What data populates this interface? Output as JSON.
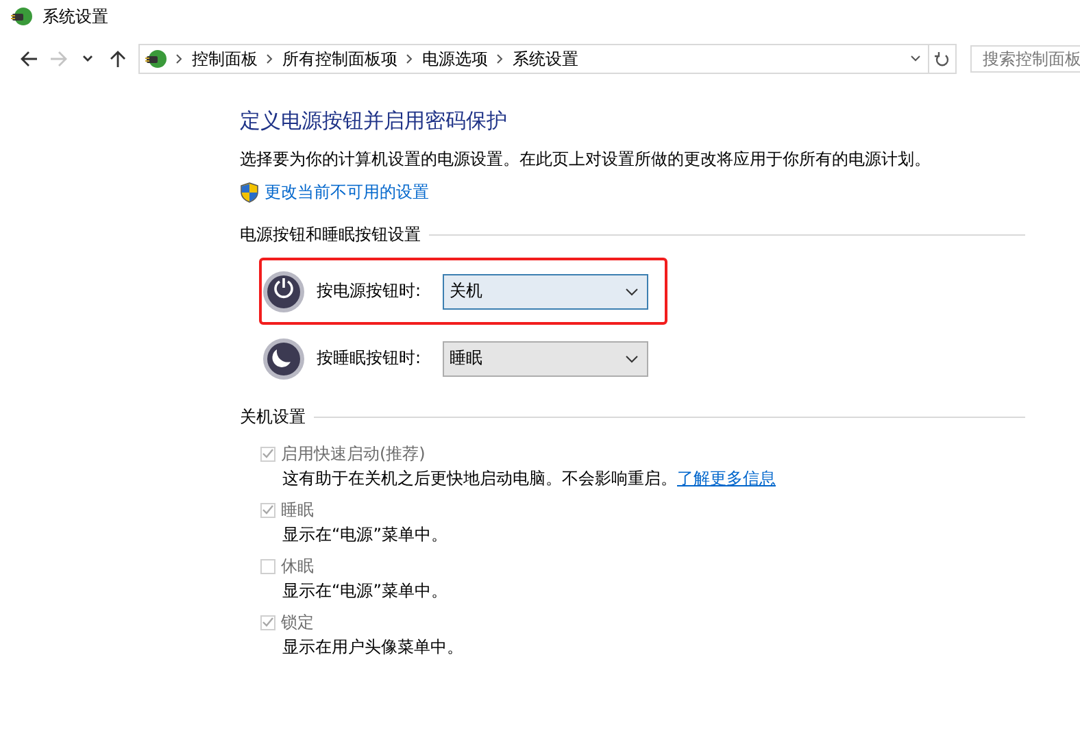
{
  "window": {
    "title": "系统设置"
  },
  "nav": {
    "back_disabled": false,
    "forward_disabled": true,
    "breadcrumbs": [
      "控制面板",
      "所有控制面板项",
      "电源选项",
      "系统设置"
    ],
    "search": {
      "placeholder": "搜索控制面板"
    }
  },
  "heading": "定义电源按钮并启用密码保护",
  "description": "选择要为你的计算机设置的电源设置。在此页上对设置所做的更改将应用于你所有的电源计划。",
  "admin_link": "更改当前不可用的设置",
  "buttons_section": {
    "title": "电源按钮和睡眠按钮设置",
    "rows": [
      {
        "kind": "power",
        "label": "按电源按钮时:",
        "value": "关机",
        "focused": true,
        "highlighted": true
      },
      {
        "kind": "sleep",
        "label": "按睡眠按钮时:",
        "value": "睡眠",
        "focused": false,
        "highlighted": false
      }
    ]
  },
  "shutdown_section": {
    "title": "关机设置",
    "options": [
      {
        "label": "启用快速启动(推荐)",
        "checked": true,
        "disabled": true,
        "description": "这有助于在关机之后更快地启动电脑。不会影响重启。",
        "link": "了解更多信息"
      },
      {
        "label": "睡眠",
        "checked": true,
        "disabled": true,
        "description": "显示在“电源”菜单中。"
      },
      {
        "label": "休眠",
        "checked": false,
        "disabled": true,
        "description": "显示在“电源”菜单中。"
      },
      {
        "label": "锁定",
        "checked": true,
        "disabled": true,
        "description": "显示在用户头像菜单中。"
      }
    ]
  }
}
